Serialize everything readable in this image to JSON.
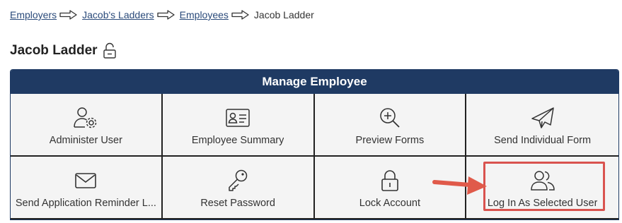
{
  "breadcrumb": {
    "items": [
      {
        "label": "Employers",
        "link": true
      },
      {
        "label": "Jacob's Ladders",
        "link": true
      },
      {
        "label": "Employees",
        "link": true
      },
      {
        "label": "Jacob Ladder",
        "link": false
      }
    ],
    "separator_icon": "arrow-right-outline-icon"
  },
  "page": {
    "title": "Jacob Ladder",
    "title_icon": "lock-open-icon"
  },
  "panel": {
    "header": "Manage Employee",
    "header_color": "#1f3a63",
    "highlight_color": "#d9534f",
    "tiles": [
      {
        "label": "Administer User",
        "icon": "user-gear-icon"
      },
      {
        "label": "Employee Summary",
        "icon": "id-card-icon"
      },
      {
        "label": "Preview Forms",
        "icon": "zoom-in-icon"
      },
      {
        "label": "Send Individual Form",
        "icon": "paper-plane-icon"
      },
      {
        "label": "Send Application Reminder L...",
        "icon": "envelope-icon"
      },
      {
        "label": "Reset Password",
        "icon": "key-icon"
      },
      {
        "label": "Lock Account",
        "icon": "lock-icon"
      },
      {
        "label": "Log In As Selected User",
        "icon": "users-icon",
        "highlighted": true
      }
    ]
  }
}
